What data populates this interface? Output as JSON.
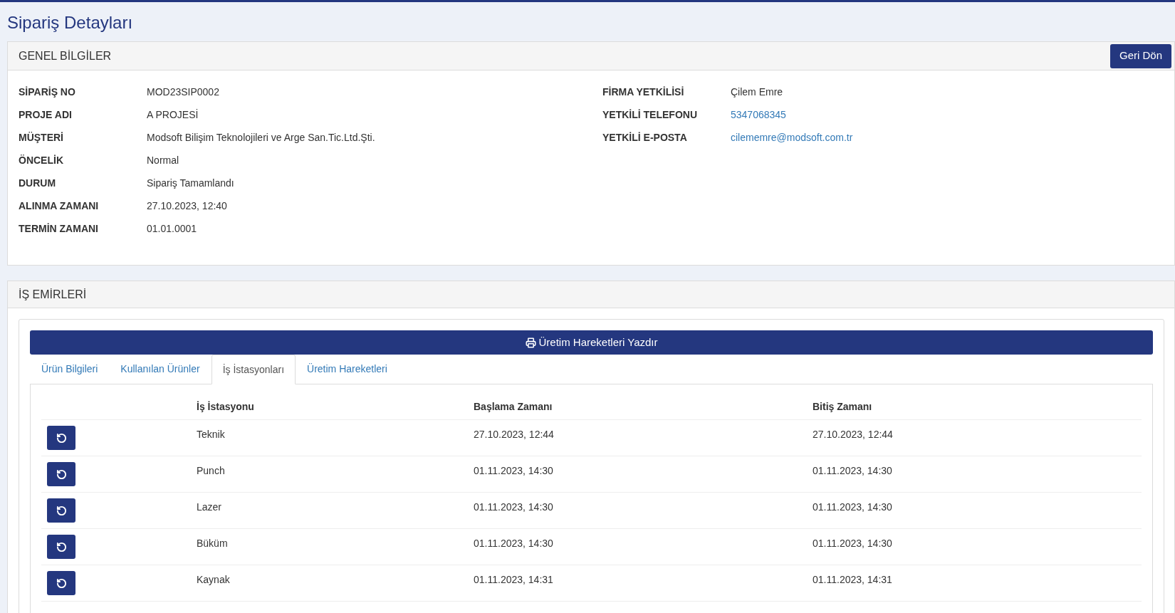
{
  "page_title": "Sipariş Detayları",
  "general": {
    "title": "GENEL BİLGİLER",
    "back_button": "Geri Dön",
    "left_fields": [
      {
        "label": "SİPARİŞ NO",
        "value": "MOD23SIP0002",
        "kind": "text"
      },
      {
        "label": "PROJE ADI",
        "value": "A PROJESİ",
        "kind": "text"
      },
      {
        "label": "MÜŞTERİ",
        "value": "Modsoft Bilişim Teknolojileri ve Arge San.Tic.Ltd.Şti.",
        "kind": "text"
      },
      {
        "label": "ÖNCELİK",
        "value": "Normal",
        "kind": "text"
      },
      {
        "label": "DURUM",
        "value": "Sipariş Tamamlandı",
        "kind": "text"
      },
      {
        "label": "ALINMA ZAMANI",
        "value": "27.10.2023, 12:40",
        "kind": "text"
      },
      {
        "label": "TERMİN ZAMANI",
        "value": "01.01.0001",
        "kind": "text"
      }
    ],
    "right_fields": [
      {
        "label": "FİRMA YETKİLİSİ",
        "value": "Çilem Emre",
        "kind": "text"
      },
      {
        "label": "YETKİLİ TELEFONU",
        "value": "5347068345",
        "kind": "link"
      },
      {
        "label": "YETKİLİ E-POSTA",
        "value": "cilememre@modsoft.com.tr",
        "kind": "link"
      }
    ]
  },
  "work_orders": {
    "title": "İŞ EMİRLERİ",
    "print_button": "Üretim Hareketleri Yazdır",
    "tabs": [
      {
        "label": "Ürün Bilgileri",
        "selected": false
      },
      {
        "label": "Kullanılan Ürünler",
        "selected": false
      },
      {
        "label": "İş İstasyonları",
        "selected": true
      },
      {
        "label": "Üretim Hareketleri",
        "selected": false
      }
    ],
    "table": {
      "columns": [
        "İş İstasyonu",
        "Başlama Zamanı",
        "Bitiş Zamanı"
      ],
      "rows": [
        {
          "station": "Teknik",
          "start": "27.10.2023, 12:44",
          "end": "27.10.2023, 12:44"
        },
        {
          "station": "Punch",
          "start": "01.11.2023, 14:30",
          "end": "01.11.2023, 14:30"
        },
        {
          "station": "Lazer",
          "start": "01.11.2023, 14:30",
          "end": "01.11.2023, 14:30"
        },
        {
          "station": "Büküm",
          "start": "01.11.2023, 14:30",
          "end": "01.11.2023, 14:30"
        },
        {
          "station": "Kaynak",
          "start": "01.11.2023, 14:31",
          "end": "01.11.2023, 14:31"
        }
      ]
    }
  }
}
